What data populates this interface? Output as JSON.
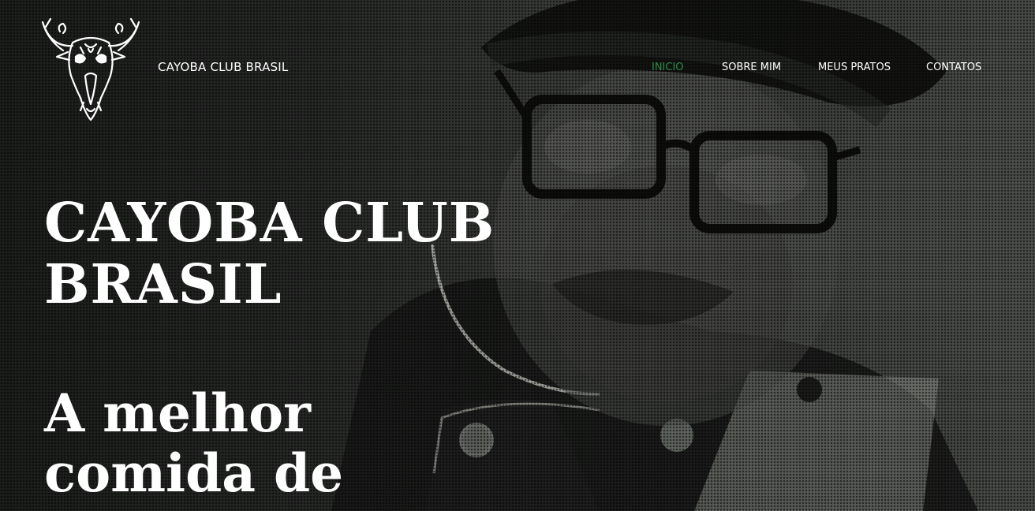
{
  "header": {
    "brand_name": "CAYOBA CLUB BRASIL",
    "logo_icon": "bull-skull-icon"
  },
  "nav": {
    "items": [
      {
        "label": "INICIO",
        "active": true
      },
      {
        "label": "SOBRE MIM",
        "active": false
      },
      {
        "label": "MEUS PRATOS",
        "active": false
      },
      {
        "label": "CONTATOS",
        "active": false
      }
    ]
  },
  "hero": {
    "title_line1": "CAYOBA CLUB",
    "title_line2": "BRASIL",
    "tagline_line1": "A melhor",
    "tagline_line2": "comida de"
  },
  "colors": {
    "active_nav": "#2e8b47",
    "text": "#ffffff",
    "background": "#2b2d2b"
  }
}
